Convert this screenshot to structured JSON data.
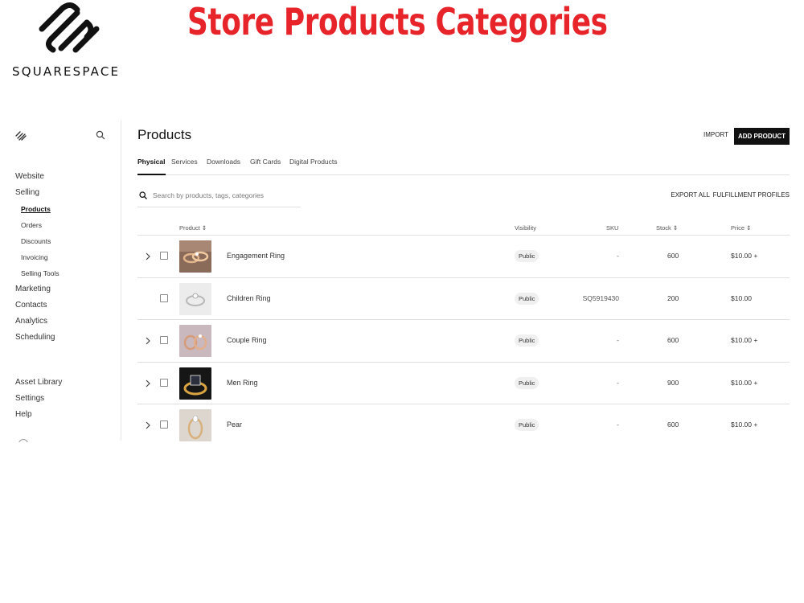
{
  "banner": {
    "logo_icon": "squarespace-logo-icon",
    "brand_name": "SQUARESPACE",
    "title": "Store Products Categories",
    "title_color": "#e8242b"
  },
  "sidebar": {
    "logo_icon": "squarespace-logo-icon",
    "search_icon": "search-icon",
    "items": [
      {
        "label": "Website"
      },
      {
        "label": "Selling"
      },
      {
        "label": "Products",
        "sub": true,
        "active": true
      },
      {
        "label": "Orders",
        "sub": true
      },
      {
        "label": "Discounts",
        "sub": true
      },
      {
        "label": "Invoicing",
        "sub": true
      },
      {
        "label": "Selling Tools",
        "sub": true
      },
      {
        "label": "Marketing"
      },
      {
        "label": "Contacts"
      },
      {
        "label": "Analytics"
      },
      {
        "label": "Scheduling"
      }
    ],
    "bottom_items": [
      {
        "label": "Asset Library"
      },
      {
        "label": "Settings"
      },
      {
        "label": "Help"
      }
    ]
  },
  "header": {
    "title": "Products",
    "import_label": "IMPORT",
    "add_label": "ADD PRODUCT"
  },
  "tabs": [
    {
      "label": "Physical",
      "active": true
    },
    {
      "label": "Services"
    },
    {
      "label": "Downloads"
    },
    {
      "label": "Gift Cards"
    },
    {
      "label": "Digital Products"
    }
  ],
  "toolbar": {
    "search_placeholder": "Search by products, tags, categories",
    "export_all": "EXPORT ALL",
    "fulfillment_profiles": "FULFILLMENT PROFILES"
  },
  "table": {
    "columns": {
      "product": "Product ⇕",
      "visibility": "Visibility",
      "sku": "SKU",
      "stock": "Stock ⇕",
      "price": "Price ⇕"
    },
    "rows": [
      {
        "name": "Engagement Ring",
        "visibility": "Public",
        "sku": "-",
        "stock": "600",
        "price": "$10.00 +",
        "expandable": true,
        "thumb": "rose-gold-rings-photo"
      },
      {
        "name": "Children Ring",
        "visibility": "Public",
        "sku": "SQ5919430",
        "stock": "200",
        "price": "$10.00",
        "expandable": false,
        "thumb": "silver-ring-photo"
      },
      {
        "name": "Couple Ring",
        "visibility": "Public",
        "sku": "-",
        "stock": "600",
        "price": "$10.00 +",
        "expandable": true,
        "thumb": "couple-rings-photo"
      },
      {
        "name": "Men Ring",
        "visibility": "Public",
        "sku": "-",
        "stock": "900",
        "price": "$10.00 +",
        "expandable": true,
        "thumb": "black-gem-ring-photo"
      },
      {
        "name": "Pear",
        "visibility": "Public",
        "sku": "-",
        "stock": "600",
        "price": "$10.00 +",
        "expandable": true,
        "thumb": "pear-diamond-ring-photo"
      }
    ]
  }
}
